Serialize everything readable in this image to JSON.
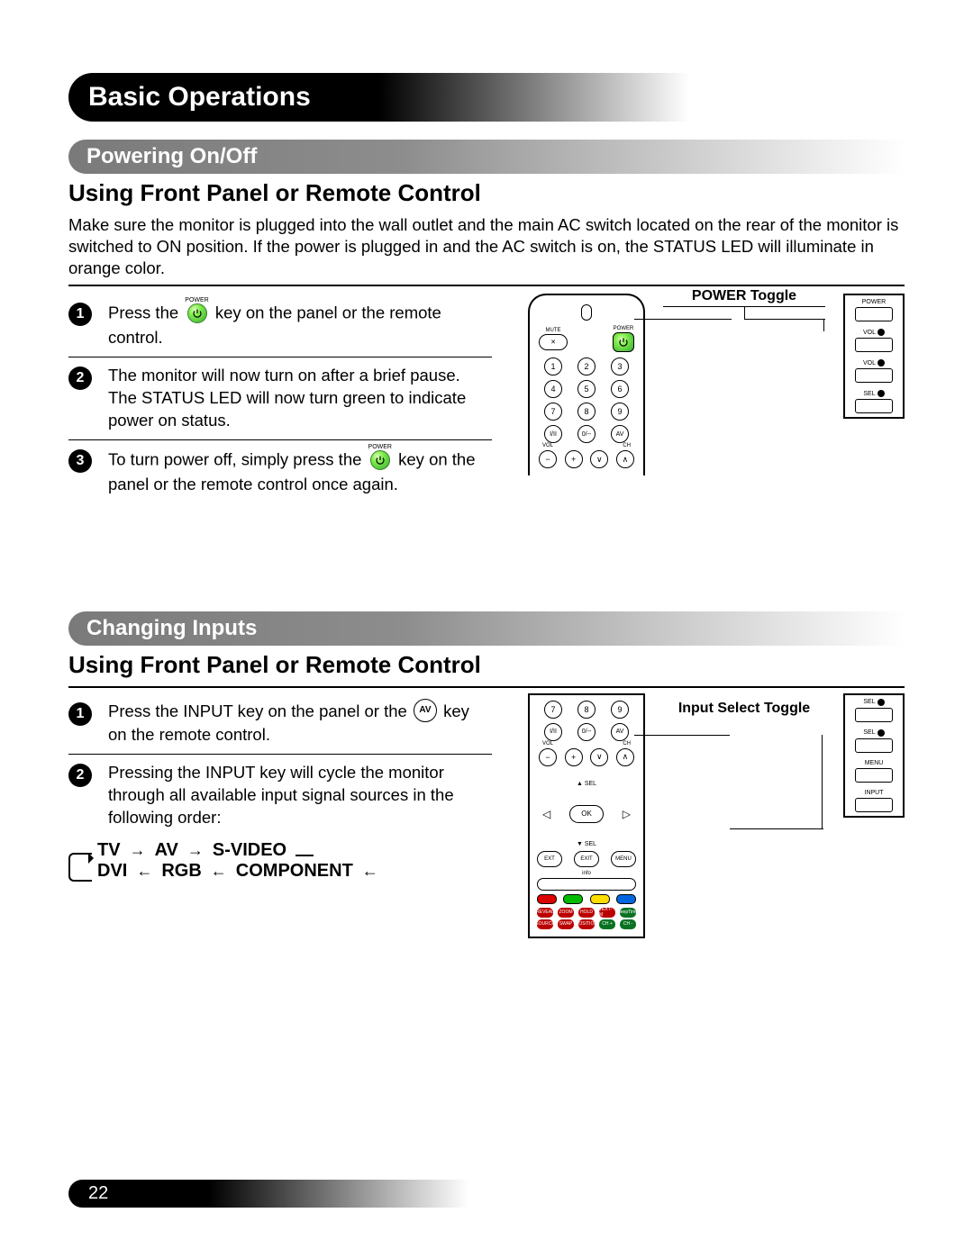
{
  "page_title": "Basic Operations",
  "page_number": "22",
  "section1": {
    "heading": "Powering On/Off",
    "subheading": "Using Front Panel or Remote Control",
    "intro": "Make sure the monitor is plugged into the wall outlet and the main AC switch located on the rear of the monitor is switched to ON position.  If the power is plugged in and the AC switch is on, the STATUS LED will illuminate in orange color.",
    "steps": [
      {
        "num": "1",
        "pre": "Press the ",
        "post": " key on the panel or the remote control.",
        "power_label": "POWER"
      },
      {
        "num": "2",
        "text": "The monitor will now turn on after a brief pause.  The STATUS LED will now turn green to indicate power on status."
      },
      {
        "num": "3",
        "pre": "To turn power off, simply press the ",
        "post": " key on the panel or the remote control once again.",
        "power_label": "POWER"
      }
    ],
    "callout": "POWER Toggle"
  },
  "section2": {
    "heading": "Changing Inputs",
    "subheading": "Using Front Panel or Remote Control",
    "steps": [
      {
        "num": "1",
        "pre": "Press the INPUT key on the panel or the ",
        "post": " key on the remote control.",
        "av_label": "AV"
      },
      {
        "num": "2",
        "text": "Pressing the INPUT key will cycle the monitor through all available input signal sources in the following order:"
      }
    ],
    "callout": "Input Select Toggle",
    "cycle": [
      "TV",
      "AV",
      "S-VIDEO",
      "DVI",
      "RGB",
      "COMPONENT"
    ]
  },
  "remote": {
    "mute": "MUTE",
    "power": "POWER",
    "numbers": [
      "1",
      "2",
      "3",
      "4",
      "5",
      "6",
      "7",
      "8",
      "9"
    ],
    "row_labels": [
      "I/II",
      "0/--",
      "AV"
    ],
    "under": {
      "vol": "VOL",
      "ch": "CH"
    },
    "symbols": [
      "−",
      "+",
      "∨",
      "∧"
    ],
    "nav": {
      "ok": "OK",
      "up": "▲ SEL",
      "down": "▼ SEL"
    },
    "three": [
      "EXT",
      "EXIT",
      "MENU"
    ],
    "info": "info",
    "bottom": [
      "REVEAL",
      "ZOOM",
      "HOLD",
      "TEXT-M",
      "SleepTimer",
      "SOURCE",
      "SWAP",
      "POSITION",
      "CH +",
      "CH -"
    ]
  },
  "side_panel_1": {
    "buttons": [
      "POWER",
      "VOL",
      "VOL",
      "SEL"
    ]
  },
  "side_panel_2": {
    "buttons": [
      "SEL",
      "SEL",
      "MENU",
      "INPUT"
    ]
  }
}
